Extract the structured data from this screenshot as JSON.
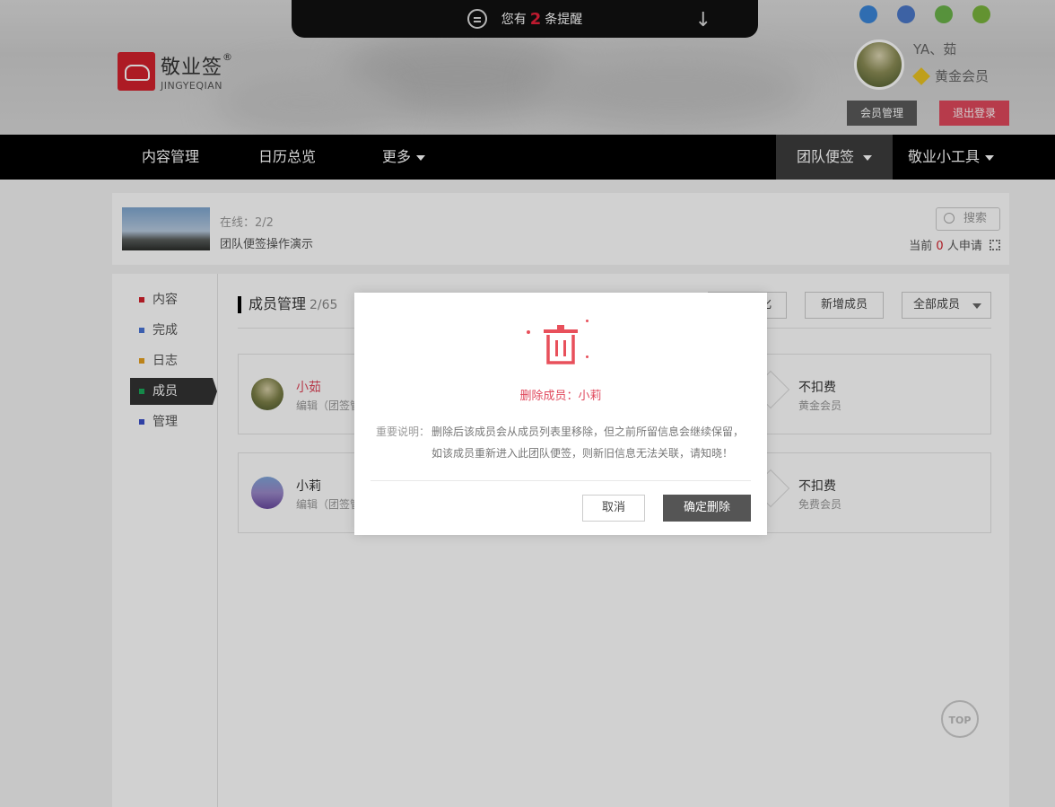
{
  "notice": {
    "prefix": "您有",
    "count": "2",
    "suffix": "条提醒"
  },
  "logo": {
    "cn": "敬业签",
    "reg": "®",
    "en": "JINGYEQIAN"
  },
  "user": {
    "name": "YA、茹",
    "level": "黄金会员",
    "member_btn": "会员管理",
    "logout_btn": "退出登录"
  },
  "nav": {
    "items": [
      "内容管理",
      "日历总览",
      "更多"
    ],
    "team": "团队便签",
    "tools": "敬业小工具"
  },
  "team": {
    "online_label": "在线：2/2",
    "name": "团队便签操作演示",
    "search": "搜索",
    "apply_prefix": "当前",
    "apply_count": "0",
    "apply_suffix": "人申请"
  },
  "sidebar": {
    "items": [
      {
        "label": "内容",
        "color": "#d3222c"
      },
      {
        "label": "完成",
        "color": "#4a74d6"
      },
      {
        "label": "日志",
        "color": "#e6a020"
      },
      {
        "label": "成员",
        "color": "#1aa85a"
      },
      {
        "label": "管理",
        "color": "#3a4fc9"
      }
    ]
  },
  "members": {
    "title": "成员管理",
    "count": "2/65",
    "btn_partial": "化",
    "btn_add": "新增成员",
    "btn_filter": "全部成员",
    "list": [
      {
        "name": "小茹",
        "role": "编辑（团签管",
        "fee": "不扣费",
        "membership": "黄金会员",
        "name_color": "#e0485c"
      },
      {
        "name": "小莉",
        "role": "编辑（团签管",
        "fee": "不扣费",
        "membership": "免费会员",
        "name_color": "#333333"
      }
    ]
  },
  "top_btn": "TOP",
  "modal": {
    "title": "删除成员：小莉",
    "note_label": "重要说明：",
    "note_line1": "删除后该成员会从成员列表里移除，但之前所留信息会继续保留，",
    "note_line2": "如该成员重新进入此团队便签，则新旧信息无法关联，请知晓！",
    "cancel": "取消",
    "confirm": "确定删除"
  }
}
